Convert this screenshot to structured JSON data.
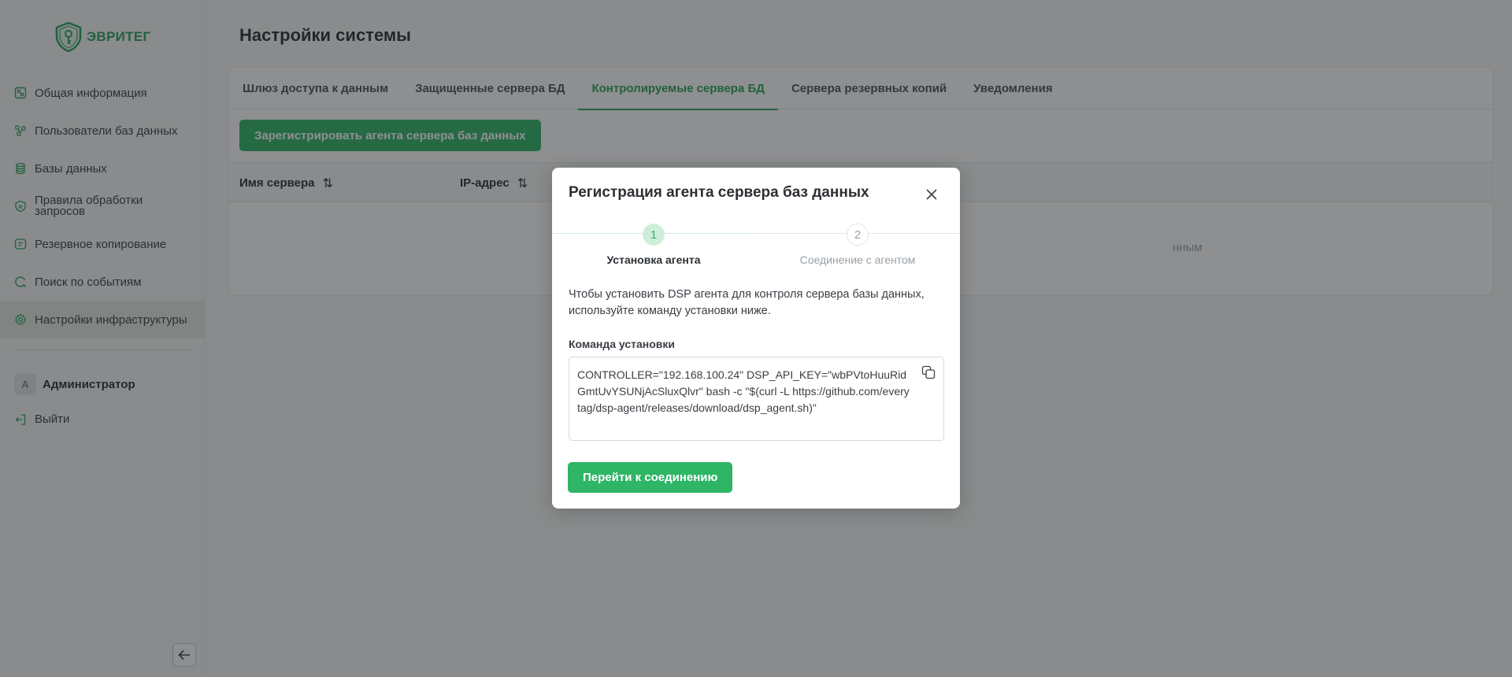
{
  "brand": {
    "name": "ЭВРИТЕГ",
    "accent": "#27a35a"
  },
  "sidebar": {
    "items": [
      {
        "label": "Общая информация",
        "icon": "dashboard-icon"
      },
      {
        "label": "Пользователи баз данных",
        "icon": "users-icon"
      },
      {
        "label": "Базы данных",
        "icon": "database-icon"
      },
      {
        "label": "Правила обработки запросов",
        "icon": "shield-icon"
      },
      {
        "label": "Резервное копирование",
        "icon": "backup-icon"
      },
      {
        "label": "Поиск по событиям",
        "icon": "search-icon"
      },
      {
        "label": "Настройки инфраструктуры",
        "icon": "gear-icon",
        "active": true
      }
    ],
    "user": {
      "initial": "А",
      "name": "Администратор"
    },
    "logout_label": "Выйти"
  },
  "page": {
    "title": "Настройки системы",
    "tabs": [
      {
        "label": "Шлюз доступа к данным"
      },
      {
        "label": "Защищенные сервера БД"
      },
      {
        "label": "Контролируемые сервера БД",
        "active": true
      },
      {
        "label": "Сервера резервных копий"
      },
      {
        "label": "Уведомления"
      }
    ],
    "register_button": "Зарегистрировать агента сервера баз данных",
    "columns": [
      "Имя сервера",
      "IP-адрес"
    ],
    "sort_glyph": "⇅",
    "empty_text_partial": "нным"
  },
  "modal": {
    "title": "Регистрация агента сервера баз данных",
    "steps": [
      {
        "number": "1",
        "label": "Установка агента",
        "active": true
      },
      {
        "number": "2",
        "label": "Соединение с агентом",
        "active": false
      }
    ],
    "description": "Чтобы установить DSP агента для контроля сервера базы данных, используйте команду установки ниже.",
    "command_label": "Команда установки",
    "command": "CONTROLLER=\"192.168.100.24\" DSP_API_KEY=\"wbPVtoHuuRidGmtUvYSUNjAcSluxQlvr\" bash -c \"$(curl -L https://github.com/everytag/dsp-agent/releases/download/dsp_agent.sh)\"",
    "next_button": "Перейти к соединению"
  }
}
